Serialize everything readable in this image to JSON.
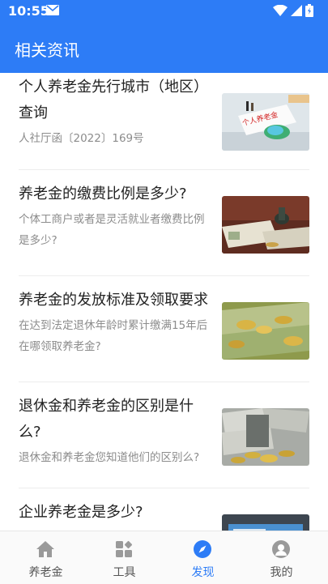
{
  "status_bar": {
    "time": "10:55"
  },
  "header": {
    "title": "相关资讯"
  },
  "articles": [
    {
      "title": "个人养老金先行城市（地区）查询",
      "desc": "人社厅函〔2022〕169号",
      "thumb_text": "个人养老金"
    },
    {
      "title": "养老金的缴费比例是多少?",
      "desc": "个体工商户或者是灵活就业者缴费比例是多少?"
    },
    {
      "title": "养老金的发放标准及领取要求",
      "desc": "在达到法定退休年龄时累计缴满15年后在哪领取养老金?"
    },
    {
      "title": "退休金和养老金的区别是什么?",
      "desc": "退休金和养老金您知道他们的区别么?"
    },
    {
      "title": "企业养老金是多少?",
      "desc": ""
    }
  ],
  "tabs": [
    {
      "label": "养老金",
      "icon": "home-icon"
    },
    {
      "label": "工具",
      "icon": "tools-icon"
    },
    {
      "label": "发现",
      "icon": "compass-icon",
      "active": true
    },
    {
      "label": "我的",
      "icon": "profile-icon"
    }
  ],
  "colors": {
    "primary": "#2d7cf6",
    "text": "#222222",
    "subtext": "#8c8c8c"
  }
}
